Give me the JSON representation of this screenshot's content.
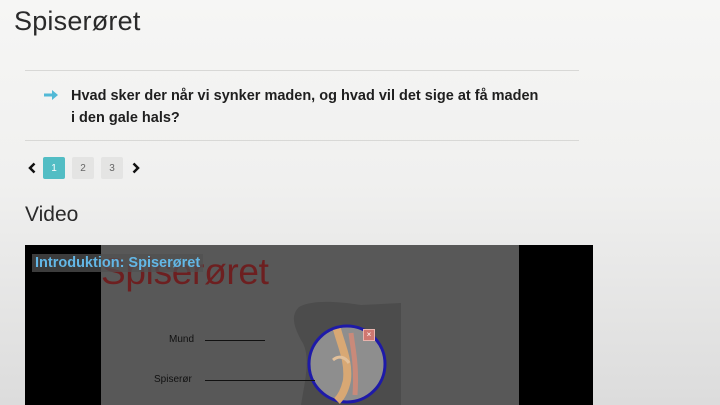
{
  "page": {
    "title": "Spiserøret"
  },
  "question": {
    "text": "Hvad sker der når vi synker maden, og hvad vil det sige at få maden i den gale hals?"
  },
  "pagination": {
    "pages": [
      "1",
      "2",
      "3"
    ],
    "active": "1"
  },
  "video_section": {
    "heading": "Video",
    "badge": "Introduktion: Spiserøret",
    "frame_title": "Spiserøret",
    "label_mouth": "Mund",
    "label_esophagus": "Spiserør",
    "close_symbol": "×"
  },
  "colors": {
    "accent": "#52bdc4",
    "arrow": "#52b9d6",
    "video_badge": "#63b7e6",
    "frame_title": "#6d1f20"
  },
  "icons": {
    "bullet": "arrow-right-icon",
    "prev": "chevron-left-icon",
    "next": "chevron-right-icon"
  }
}
